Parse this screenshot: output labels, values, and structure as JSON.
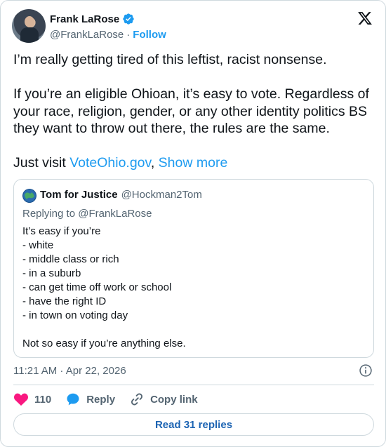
{
  "author": {
    "name": "Frank LaRose",
    "handle": "@FrankLaRose",
    "separator": "·",
    "follow_label": "Follow"
  },
  "tweet": {
    "paragraphs": [
      "I’m really getting tired of this leftist, racist nonsense.",
      "If you’re an eligible Ohioan, it’s easy to vote. Regardless of your race, religion, gender, or any other identity politics BS they want to throw out there, the rules are the same."
    ],
    "last_prefix": "Just visit ",
    "link_text": "VoteOhio.gov",
    "last_suffix": ", ",
    "show_more": "Show more"
  },
  "quoted": {
    "name": "Tom for Justice",
    "handle": "@Hockman2Tom",
    "replying_prefix": "Replying to ",
    "replying_to": "@FrankLaRose",
    "lines": [
      "It’s easy if you’re",
      "- white",
      "- middle class or rich",
      "- in a suburb",
      "- can get time off work or school",
      "- have the right ID",
      "- in town on voting day",
      "",
      "Not so easy if you’re anything else."
    ]
  },
  "meta": {
    "timestamp": "11:21 AM · Apr 22, 2026"
  },
  "actions": {
    "like_count": "110",
    "reply_label": "Reply",
    "copy_label": "Copy link"
  },
  "read_replies_label": "Read 31 replies",
  "colors": {
    "accent": "#1d9bf0",
    "like": "#f91880",
    "text": "#0f1419",
    "muted": "#536471",
    "border": "#cfd9de"
  }
}
